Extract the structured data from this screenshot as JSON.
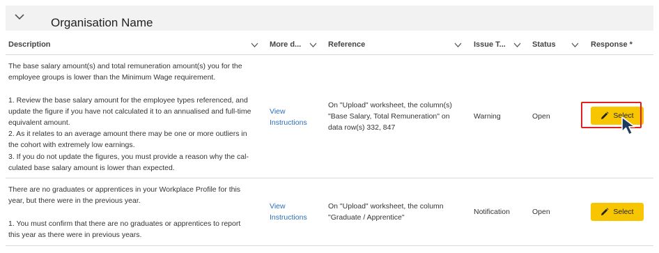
{
  "group": {
    "title": "Organisation Name",
    "chevron_icon": "chevron-down-icon"
  },
  "columns": [
    {
      "label": "Description"
    },
    {
      "label": "More d..."
    },
    {
      "label": "Reference"
    },
    {
      "label": "Issue T..."
    },
    {
      "label": "Status"
    },
    {
      "label": "Response *"
    }
  ],
  "rows": [
    {
      "description": "The base salary amount(s) and total remuneration amount(s) you for the\nemployee groups is lower than the Minimum Wage requirement.\n\n1. Review the base salary amount for the employee types referenced, and\nupdate the figure if you have not calculated it to an annualised and full-time\nequivalent amount.\n2. As it relates to an average amount there may be one or more outliers in\nthe cohort with extremely low earnings.\n3. If you do not update the figures, you must provide a reason why the cal-\nculated base salary amount is lower than expected.",
      "more_details": "View\nInstructions",
      "reference": "On \"Upload\" worksheet, the column(s)\n\"Base Salary, Total Remuneration\" on\ndata row(s) 332, 847",
      "issue_type": "Warning",
      "status": "Open",
      "response_label": "Select"
    },
    {
      "description": "There are no graduates or apprentices in your Workplace Profile for this\nyear, but there were in the previous year.\n\n1. You must confirm that there are no graduates or apprentices to report\nthis year as there were in previous years.",
      "more_details": "View\nInstructions",
      "reference": "On \"Upload\" worksheet, the column\n\"Graduate / Apprentice\"",
      "issue_type": "Notification",
      "status": "Open",
      "response_label": "Select"
    }
  ],
  "colors": {
    "accent_button": "#f7c600",
    "link": "#2a6ebb",
    "highlight": "#e02020"
  }
}
